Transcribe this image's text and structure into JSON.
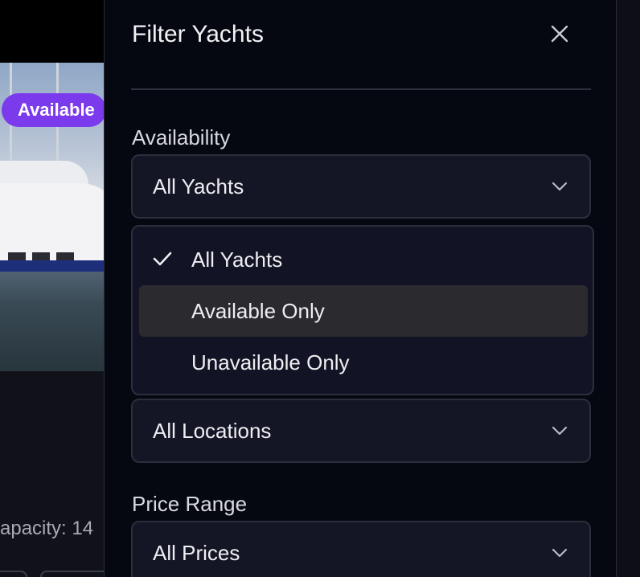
{
  "background": {
    "badge_label": "Available",
    "capacity_text": "apacity: 14"
  },
  "panel": {
    "title": "Filter Yachts",
    "close_icon": "close-icon",
    "availability": {
      "label": "Availability",
      "selected": "All Yachts",
      "options": [
        {
          "label": "All Yachts",
          "checked": true
        },
        {
          "label": "Available Only",
          "checked": false,
          "highlighted": true
        },
        {
          "label": "Unavailable Only",
          "checked": false
        }
      ]
    },
    "location": {
      "selected": "All Locations"
    },
    "price": {
      "label": "Price Range",
      "selected": "All Prices"
    }
  },
  "colors": {
    "panel_bg": "#060811",
    "select_bg": "#141626",
    "highlight": "#2b2b2f",
    "badge": "#7c3aed"
  }
}
